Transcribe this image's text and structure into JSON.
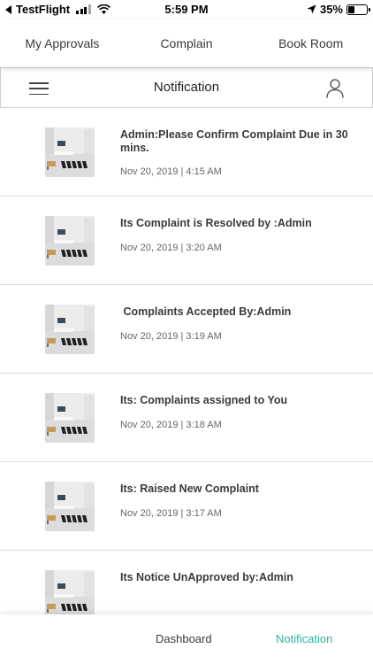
{
  "status_bar": {
    "carrier": "TestFlight",
    "time": "5:59 PM",
    "battery_pct": "35%",
    "battery_level": 0.35
  },
  "top_tabs": [
    "My Approvals",
    "Complain",
    "Book Room"
  ],
  "header": {
    "title": "Notification"
  },
  "notifications": [
    {
      "message": "Admin:Please Confirm Complaint Due in 30 mins.",
      "date": "Nov 20, 2019 | 4:15 AM"
    },
    {
      "message": "Its Complaint is Resolved by :Admin",
      "date": "Nov 20, 2019 | 3:20 AM"
    },
    {
      "message": " Complaints Accepted By:Admin",
      "date": "Nov 20, 2019 | 3:19 AM"
    },
    {
      "message": "Its: Complaints assigned to You",
      "date": "Nov 20, 2019 | 3:18 AM"
    },
    {
      "message": "Its: Raised New Complaint",
      "date": "Nov 20, 2019 | 3:17 AM"
    },
    {
      "message": "Its Notice UnApproved by:Admin",
      "date": ""
    }
  ],
  "bottom_nav": {
    "dashboard": "Dashboard",
    "notification": "Notification"
  },
  "colors": {
    "accent": "#2bb59a",
    "nav_inactive": "#3a3a3a"
  }
}
